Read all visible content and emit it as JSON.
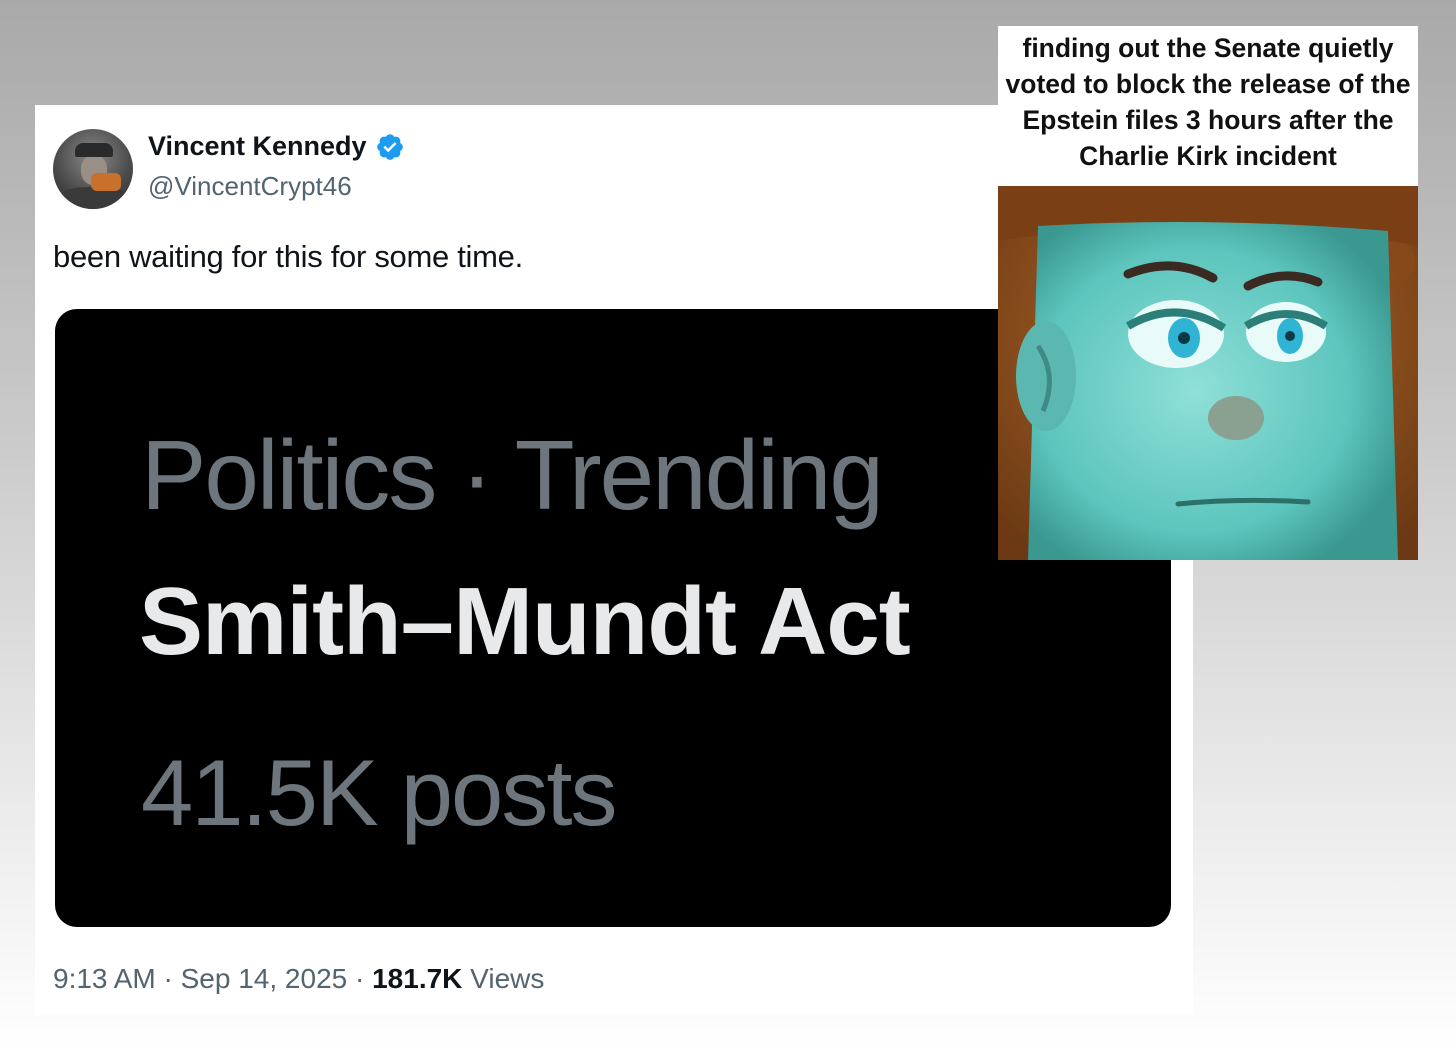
{
  "tweet": {
    "author": {
      "display_name": "Vincent Kennedy",
      "handle": "@VincentCrypt46",
      "verified": true,
      "avatar_icon": "profile-photo-icon"
    },
    "text": "been waiting for this for some time.",
    "embedded_trend": {
      "category": "Politics · Trending",
      "title": "Smith–Mundt Act",
      "post_count": "41.5K posts"
    },
    "footer": {
      "time": "9:13 AM",
      "separator": " · ",
      "date": "Sep 14, 2025",
      "views_count": "181.7K",
      "views_label": " Views"
    }
  },
  "meme": {
    "caption": "finding out the Senate quietly voted to block the release of the Epstein files 3 hours after the Charlie Kirk incident",
    "image_icon": "woody-face-illustration"
  },
  "colors": {
    "verified_blue": "#1d9bf0",
    "text_primary": "#0f1419",
    "text_secondary": "#536471",
    "embed_background": "#000000",
    "trend_muted": "#6e767d",
    "trend_title": "#e7e9ea"
  }
}
